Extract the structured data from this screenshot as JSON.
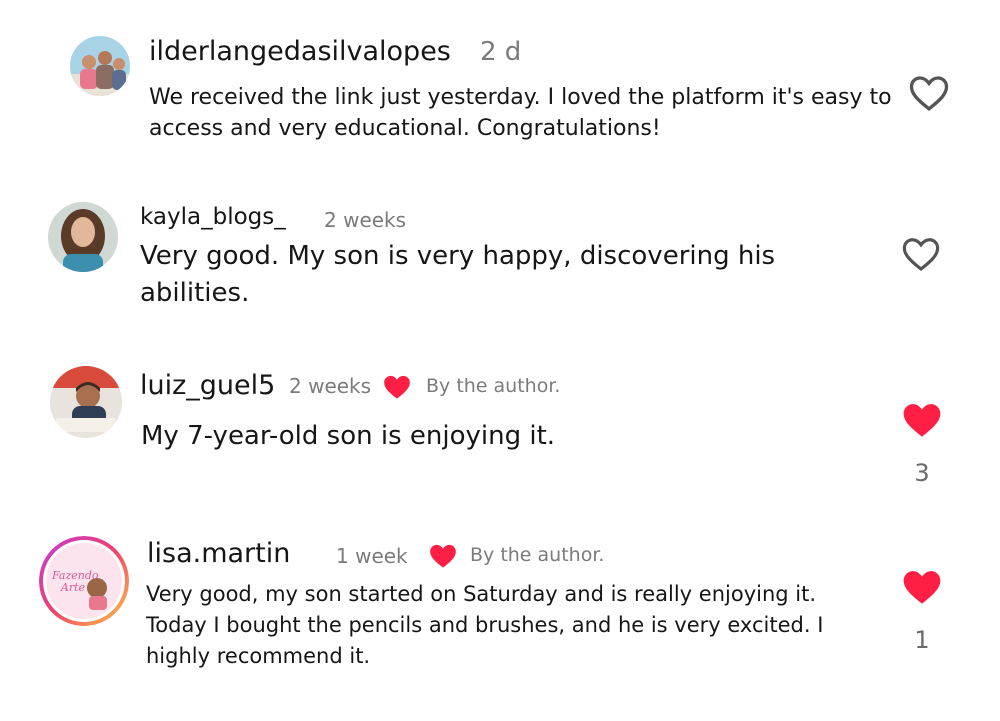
{
  "colors": {
    "accent_red": "#ff1f44",
    "muted": "#7b7b7b",
    "text": "#161616"
  },
  "comments": [
    {
      "username": "ilderlangedasilvalopes",
      "time": "2 d",
      "text": "We received the link just yesterday. I loved the platform it's easy to access and very educational. Congratulations!",
      "liked": false,
      "like_icon": "heart-outline-icon"
    },
    {
      "username": "kayla_blogs_",
      "time": "2 weeks",
      "text": "Very good. My son is very happy, discovering his abilities.",
      "liked": false,
      "like_icon": "heart-outline-icon"
    },
    {
      "username": "luiz_guel5",
      "time": "2 weeks",
      "author_label": "By the author.",
      "text": "My 7-year-old son is enjoying it.",
      "liked": true,
      "like_icon": "heart-filled-icon",
      "like_count": "3"
    },
    {
      "username": "lisa.martin",
      "time": "1 week",
      "author_label": "By the author.",
      "text": "Very good, my son started on Saturday and is really enjoying it. Today I bought the pencils and brushes, and he is very excited. I highly recommend it.",
      "liked": true,
      "like_icon": "heart-filled-icon",
      "like_count": "1",
      "avatar_logo_text": "Fazendo Arte"
    }
  ]
}
